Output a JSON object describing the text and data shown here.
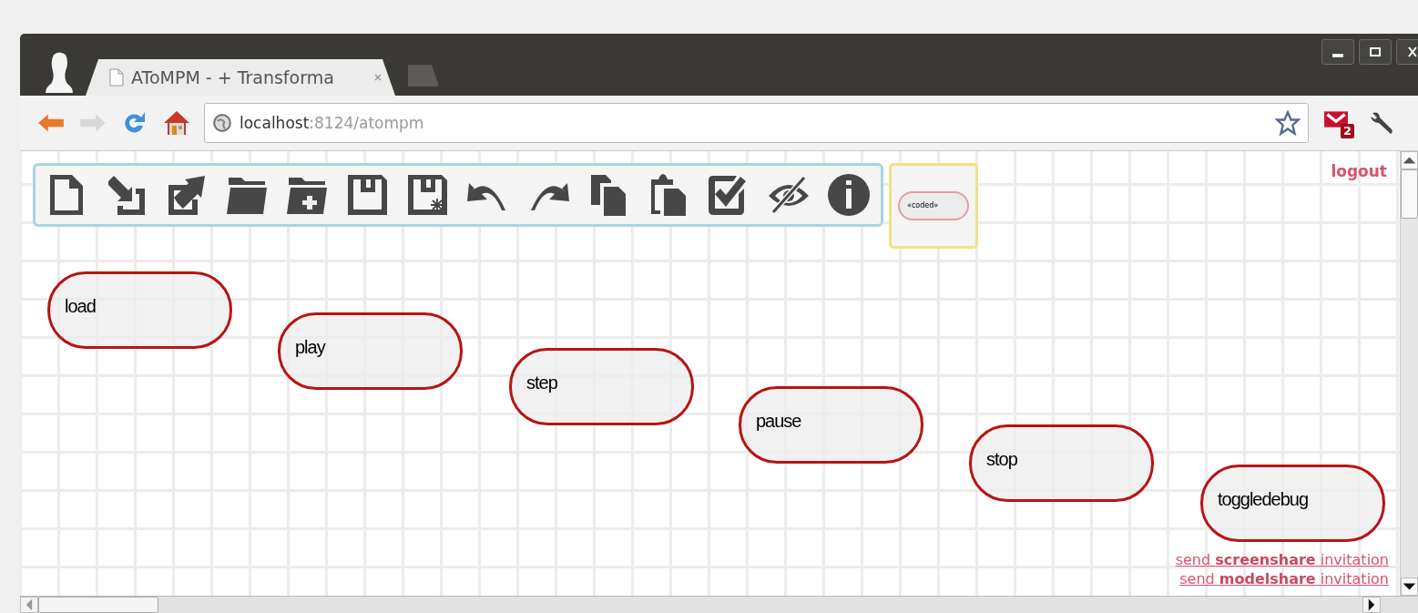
{
  "browser": {
    "tab": {
      "title": "AToMPM - + Transforma"
    },
    "address": {
      "host": "localhost",
      "path": ":8124/atompm"
    },
    "mail_badge": "2"
  },
  "toolbar": [
    {
      "kind": "new"
    },
    {
      "kind": "import"
    },
    {
      "kind": "export"
    },
    {
      "kind": "open"
    },
    {
      "kind": "openplus"
    },
    {
      "kind": "save"
    },
    {
      "kind": "saveas"
    },
    {
      "kind": "undo"
    },
    {
      "kind": "redo"
    },
    {
      "kind": "copy"
    },
    {
      "kind": "paste"
    },
    {
      "kind": "validate"
    },
    {
      "kind": "hide"
    },
    {
      "kind": "info"
    }
  ],
  "palette": {
    "items": [
      {
        "label": "«coded»"
      }
    ]
  },
  "logout": "logout",
  "nodes": [
    {
      "label": "load"
    },
    {
      "label": "play"
    },
    {
      "label": "step"
    },
    {
      "label": "pause"
    },
    {
      "label": "stop"
    },
    {
      "label": "toggledebug"
    }
  ],
  "invitations": [
    "send **screenshare** invitation",
    "send **modelshare** invitation"
  ]
}
